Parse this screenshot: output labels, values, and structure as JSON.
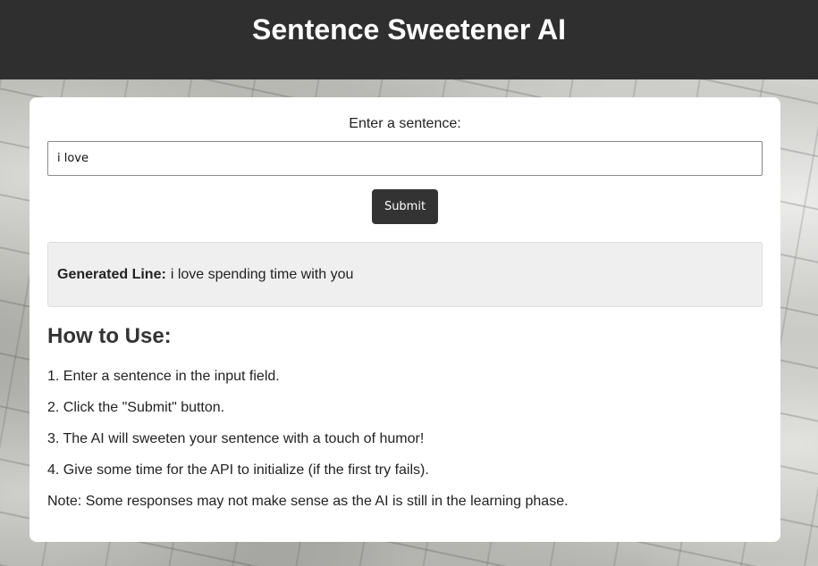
{
  "header": {
    "title": "Sentence Sweetener AI"
  },
  "form": {
    "label": "Enter a sentence:",
    "input_value": "i love",
    "input_placeholder": "",
    "submit_label": "Submit"
  },
  "result": {
    "key": "Generated Line:",
    "value": "i love spending time with you"
  },
  "instructions": {
    "heading": "How to Use:",
    "steps": [
      "1. Enter a sentence in the input field.",
      "2. Click the \"Submit\" button.",
      "3. The AI will sweeten your sentence with a touch of humor!",
      "4. Give some time for the API to initialize (if the first try fails)."
    ],
    "note": "Note: Some responses may not make sense as the AI is still in the learning phase."
  },
  "colors": {
    "header_bg": "#2f2f2f",
    "button_bg": "#333333",
    "result_bg": "#efefef"
  }
}
